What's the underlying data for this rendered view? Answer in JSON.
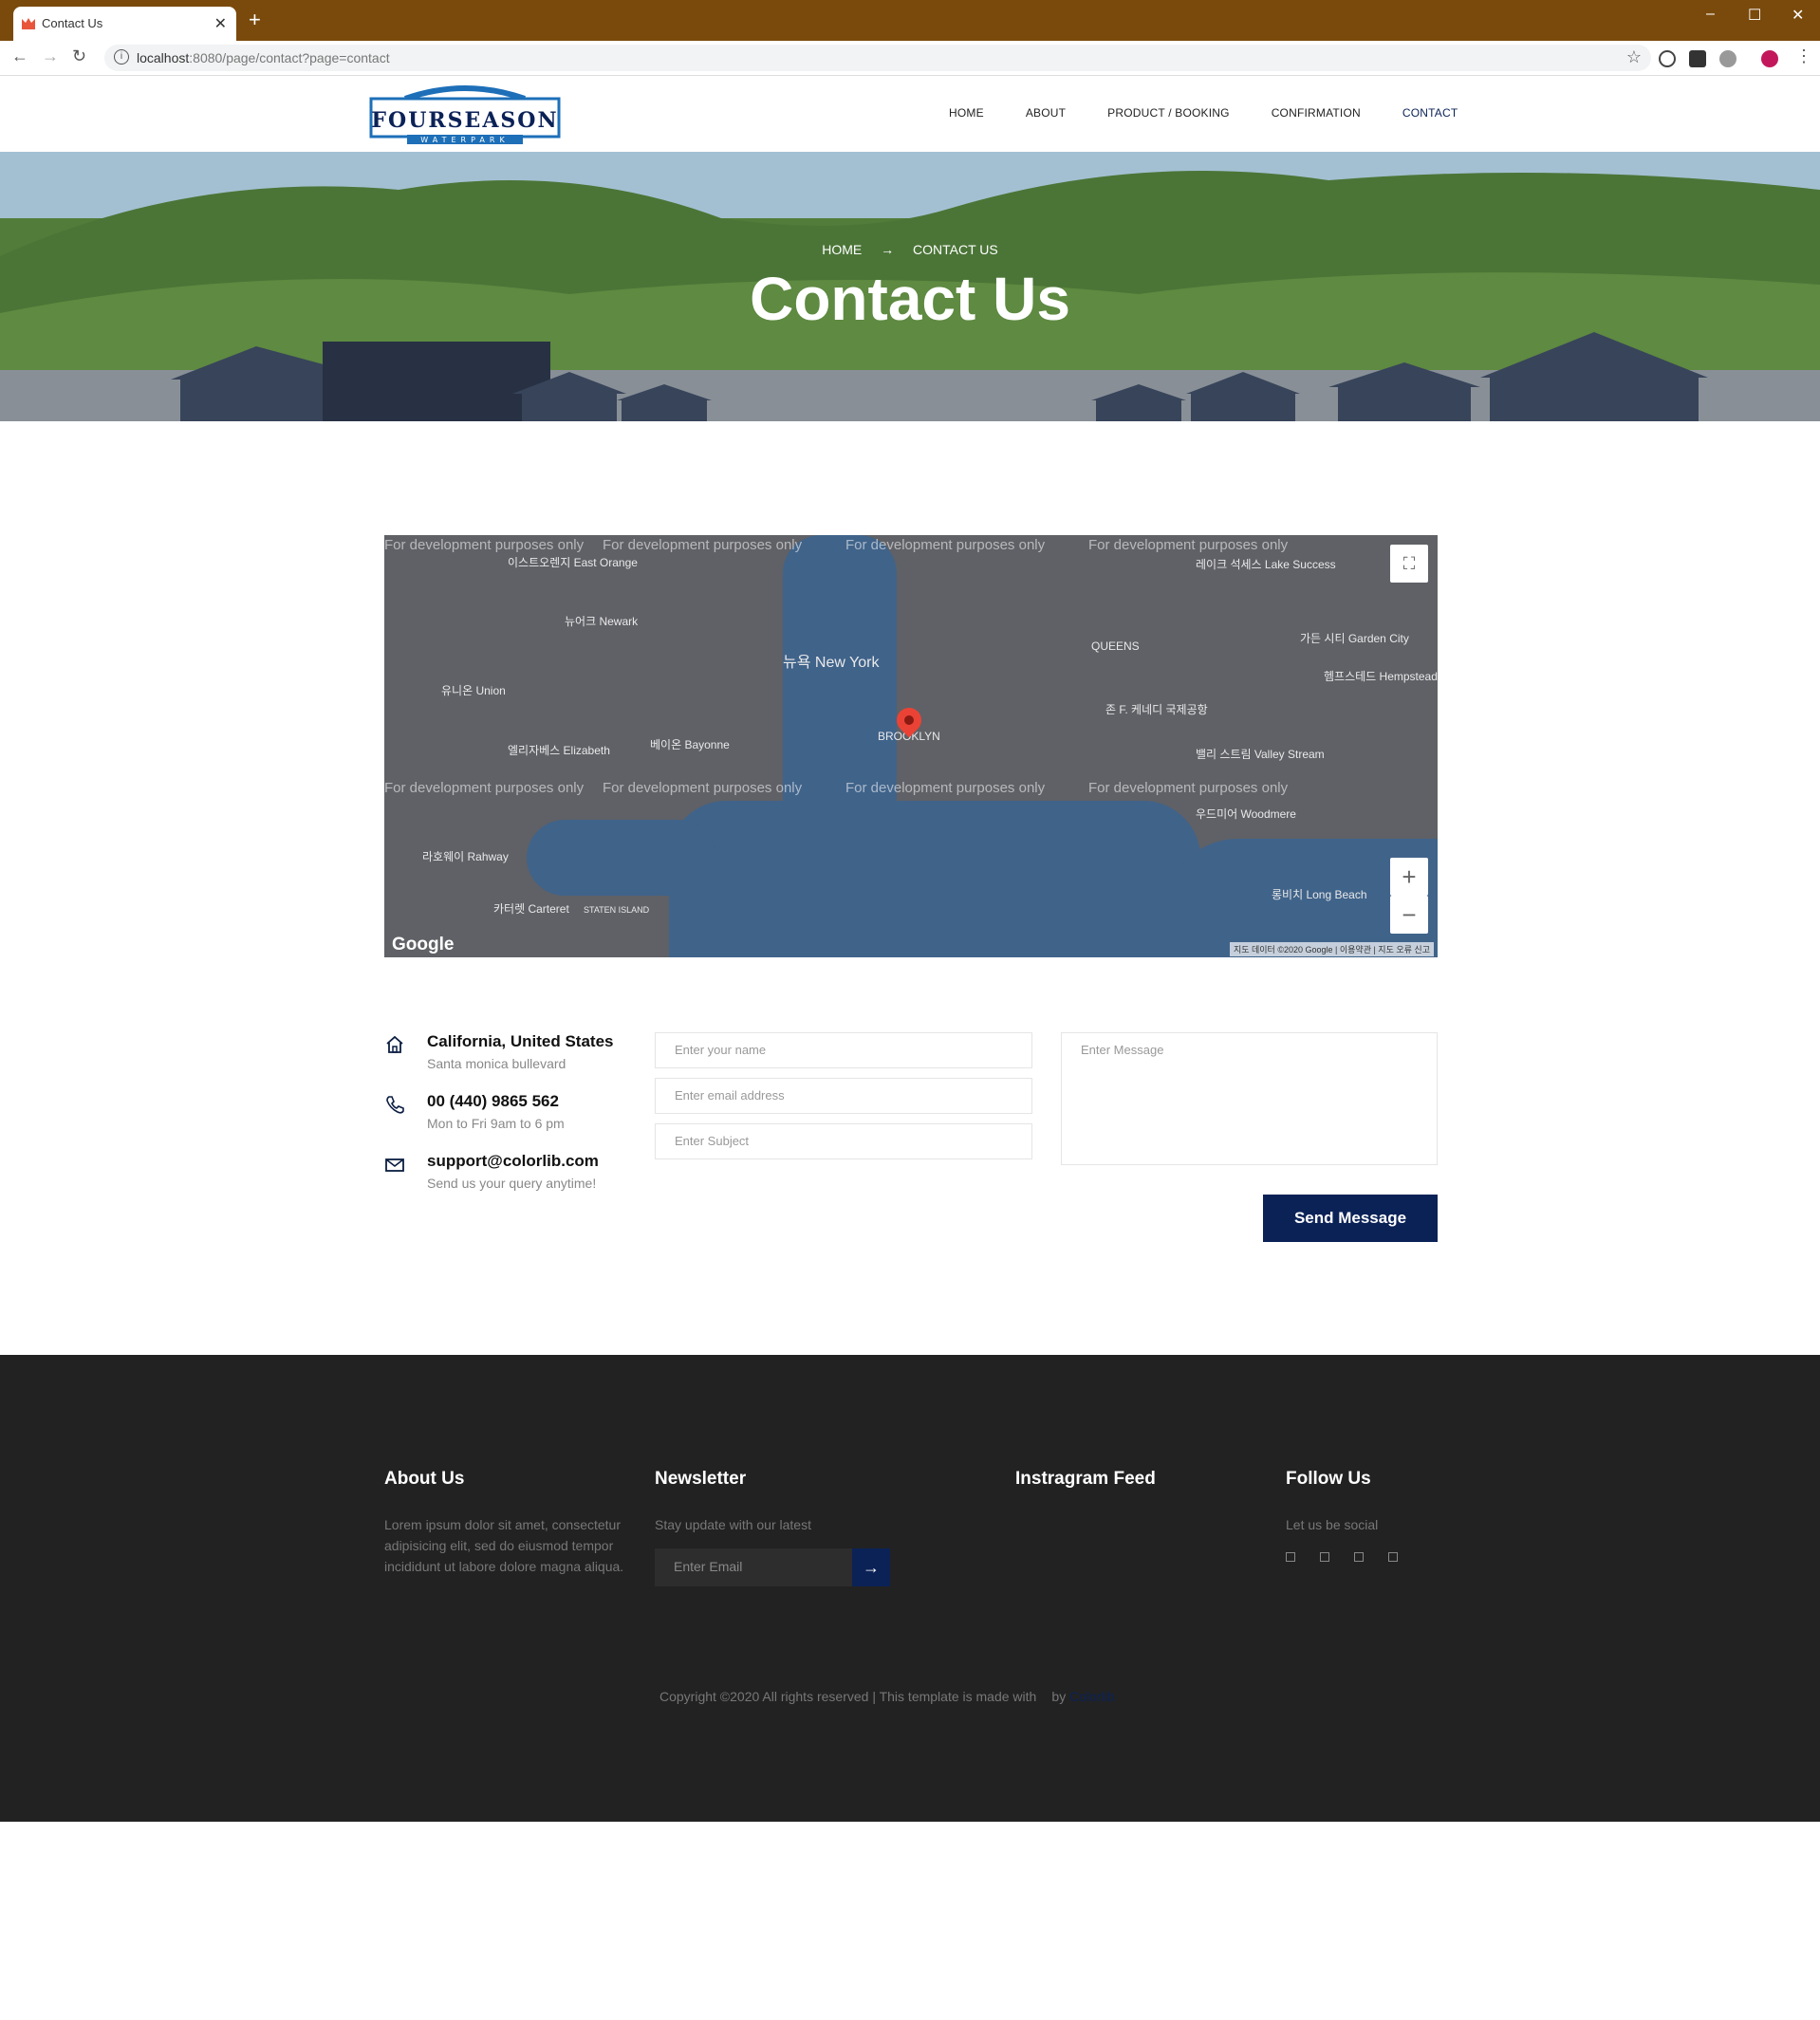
{
  "browser": {
    "tab_title": "Contact Us",
    "url_host": "localhost",
    "url_rest": ":8080/page/contact?page=contact"
  },
  "header": {
    "logo_text": "FOURSEASON",
    "logo_sub": "WATERPARK",
    "nav": [
      "HOME",
      "ABOUT",
      "PRODUCT / BOOKING",
      "CONFIRMATION",
      "CONTACT"
    ]
  },
  "hero": {
    "breadcrumb_home": "HOME",
    "breadcrumb_current": "CONTACT US",
    "title": "Contact Us"
  },
  "map": {
    "watermark": "For development purposes only",
    "google": "Google",
    "credit": "지도 데이터 ©2020 Google | 이용약관 | 지도 오류 신고",
    "labels": {
      "east_orange": "이스트오렌지 East Orange",
      "newark": "뉴어크 Newark",
      "new_york": "뉴욕 New York",
      "queens": "QUEENS",
      "brooklyn": "BROOKLYN",
      "jfk": "존 F. 케네디 국제공항",
      "elizabeth": "엘리자베스 Elizabeth",
      "bayonne": "베이온 Bayonne",
      "union": "유니온 Union",
      "hempstead": "헴프스테드 Hempstead",
      "long_beach": "롱비치 Long Beach",
      "valley_stream": "밸리 스트림 Valley Stream",
      "woodmere": "우드미어 Woodmere",
      "rahway": "라호웨이 Rahway",
      "carteret": "카터렛 Carteret",
      "lake_success": "레이크 석세스 Lake Success",
      "garden_city": "가든 시티 Garden City",
      "staten_island": "STATEN ISLAND"
    }
  },
  "contact": {
    "items": [
      {
        "icon": "home-icon",
        "title": "California, United States",
        "sub": "Santa monica bullevard"
      },
      {
        "icon": "phone-icon",
        "title": "00 (440) 9865 562",
        "sub": "Mon to Fri 9am to 6 pm"
      },
      {
        "icon": "envelope-icon",
        "title": "support@colorlib.com",
        "sub": "Send us your query anytime!"
      }
    ],
    "placeholders": {
      "name": "Enter your name",
      "email": "Enter email address",
      "subject": "Enter Subject",
      "message": "Enter Message"
    },
    "send": "Send Message"
  },
  "footer": {
    "about_head": "About Us",
    "about_text": "Lorem ipsum dolor sit amet, consectetur adipisicing elit, sed do eiusmod tempor incididunt ut labore dolore magna aliqua.",
    "news_head": "Newsletter",
    "news_text": "Stay update with our latest",
    "news_placeholder": "Enter Email",
    "insta_head": "Instragram Feed",
    "follow_head": "Follow Us",
    "follow_text": "Let us be social",
    "copyright": "Copyright ©2020 All rights reserved | This template is made with",
    "by": "by",
    "author": "Colorlib"
  },
  "colors": {
    "chrome": "#7a4a0c",
    "accent": "#0b2257",
    "footer_bg": "#222222"
  }
}
